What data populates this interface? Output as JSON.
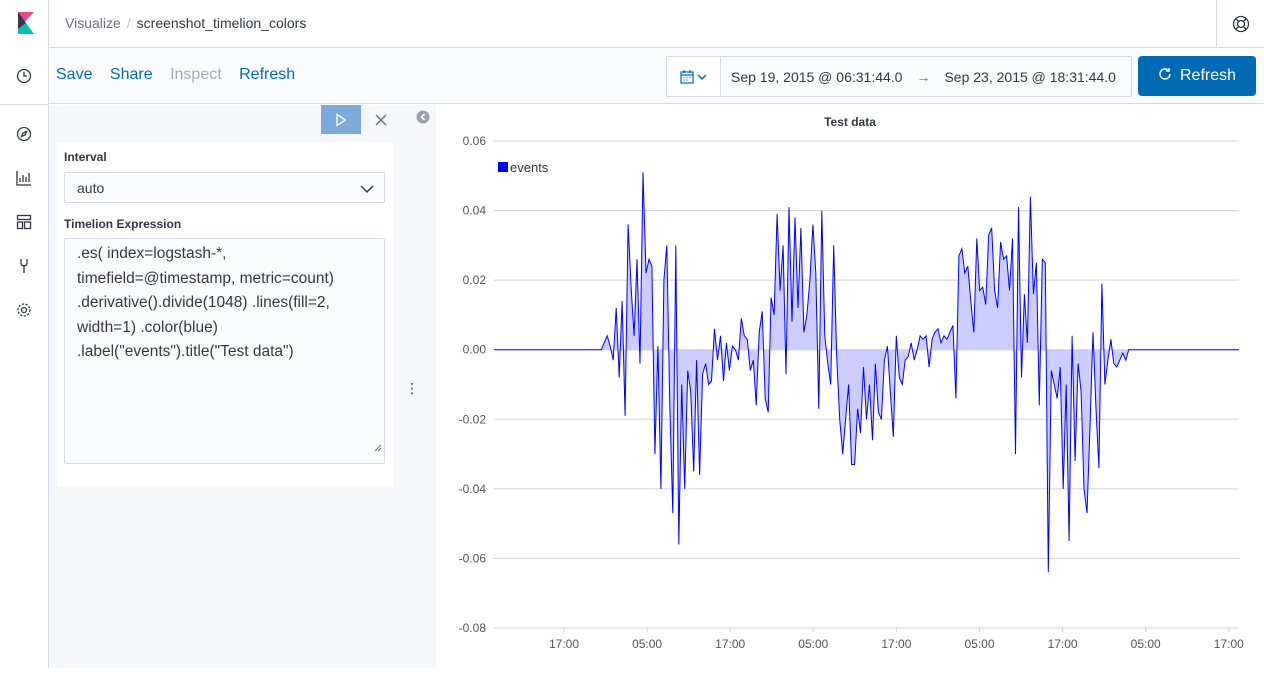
{
  "breadcrumbs": {
    "app": "Visualize",
    "current": "screenshot_timelion_colors"
  },
  "menu": {
    "save": "Save",
    "share": "Share",
    "inspect": "Inspect",
    "refresh": "Refresh"
  },
  "time": {
    "start": "Sep 19, 2015 @ 06:31:44.0",
    "arrow": "→",
    "end": "Sep 23, 2015 @ 18:31:44.0"
  },
  "refresh_button": "Refresh",
  "nav_icons": [
    "clock-icon",
    "compass-icon",
    "visualize-icon",
    "dashboard-icon",
    "devtools-icon",
    "gear-icon"
  ],
  "editor": {
    "interval_label": "Interval",
    "interval_value": "auto",
    "expression_label": "Timelion Expression",
    "expression_lines": [
      ".es( index=logstash-*,",
      "timefield=@timestamp, metric=count)",
      ".derivative().divide(1048) .lines(fill=2,",
      "width=1) .color(blue)",
      ".label(\"events\").title(\"Test data\")"
    ]
  },
  "colors": {
    "accent": "#006bb4",
    "series": "#0000ff",
    "fill": "#ccccff"
  },
  "chart_data": {
    "type": "area",
    "title": "Test data",
    "legend": [
      "events"
    ],
    "legend_position": "top-left",
    "grid": true,
    "ylim": [
      -0.08,
      0.06
    ],
    "yticks": [
      "0.06",
      "0.04",
      "0.02",
      "0.00",
      "-0.02",
      "-0.04",
      "-0.06",
      "-0.08"
    ],
    "xticks": [
      "17:00",
      "05:00",
      "17:00",
      "05:00",
      "17:00",
      "05:00",
      "17:00",
      "05:00",
      "17:00"
    ],
    "series": [
      {
        "name": "events",
        "values": [
          0,
          0,
          0,
          0,
          0,
          0,
          0,
          0,
          0,
          0,
          0,
          0,
          0,
          0,
          0,
          0,
          0,
          0,
          0,
          0,
          0,
          0,
          0,
          0,
          0,
          0,
          0,
          0,
          0,
          0,
          0,
          0,
          0,
          0,
          0,
          0,
          0,
          0.002,
          0.004,
          0.001,
          -0.003,
          0.012,
          -0.008,
          0.014,
          -0.019,
          0.036,
          0.018,
          0.004,
          0.026,
          -0.004,
          0.051,
          0.022,
          0.026,
          0.024,
          -0.03,
          0.001,
          -0.04,
          0.02,
          0.03,
          -0.016,
          -0.047,
          0.03,
          -0.056,
          -0.01,
          -0.04,
          -0.006,
          -0.012,
          -0.035,
          -0.003,
          -0.036,
          -0.007,
          -0.004,
          -0.01,
          -0.009,
          0.006,
          -0.003,
          0.004,
          -0.009,
          0.002,
          -0.006,
          0.001,
          0,
          -0.003,
          0.009,
          0.004,
          0.003,
          -0.006,
          -0.003,
          -0.016,
          0.005,
          0.011,
          -0.014,
          -0.018,
          0.015,
          0.01,
          0.039,
          0.017,
          0.03,
          -0.007,
          0.041,
          0.008,
          0.038,
          0.012,
          0.035,
          0.005,
          0.01,
          0.02,
          0.036,
          0.022,
          -0.017,
          0.04,
          0.004,
          -0.004,
          -0.01,
          0.03,
          -0.002,
          -0.02,
          -0.03,
          -0.02,
          -0.01,
          -0.033,
          -0.033,
          -0.017,
          -0.024,
          -0.005,
          -0.02,
          -0.01,
          -0.026,
          -0.004,
          -0.018,
          -0.02,
          -0.003,
          0.001,
          -0.012,
          -0.025,
          0.004,
          -0.008,
          -0.01,
          -0.003,
          -0.002,
          0.002,
          -0.003,
          0,
          0.004,
          0.003,
          0.004,
          -0.005,
          0.003,
          0.005,
          0.006,
          0.002,
          0.004,
          0.003,
          0.005,
          0.007,
          -0.014,
          0.027,
          0.029,
          0.022,
          0.024,
          0.014,
          0.005,
          0.032,
          0.017,
          0.018,
          0.013,
          0.033,
          0.035,
          0.017,
          0.012,
          0.031,
          0.026,
          0.027,
          0.017,
          0.032,
          -0.03,
          0.041,
          -0.008,
          0.016,
          0.002,
          0.044,
          0.016,
          0.025,
          -0.016,
          0.026,
          0.025,
          -0.064,
          -0.006,
          -0.01,
          -0.014,
          -0.005,
          -0.04,
          -0.01,
          -0.055,
          0.004,
          -0.032,
          -0.004,
          -0.012,
          -0.04,
          -0.047,
          -0.022,
          0.005,
          -0.017,
          -0.034,
          0.019,
          -0.01,
          -0.003,
          0.003,
          -0.004,
          -0.005,
          -0.003,
          -0.001,
          -0.003,
          0,
          0,
          0,
          0,
          0,
          0,
          0,
          0,
          0,
          0,
          0,
          0,
          0,
          0,
          0,
          0,
          0,
          0,
          0,
          0,
          0,
          0,
          0,
          0,
          0,
          0,
          0,
          0,
          0,
          0,
          0,
          0,
          0,
          0,
          0,
          0,
          0,
          0
        ]
      }
    ]
  }
}
